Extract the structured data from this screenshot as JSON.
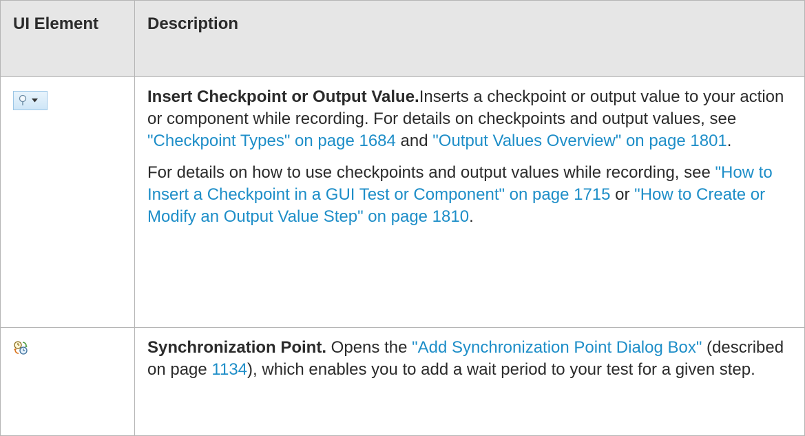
{
  "table": {
    "header": {
      "col1": "UI Element",
      "col2": "Description"
    },
    "rows": [
      {
        "icon": "checkpoint-dropdown-icon",
        "title": "Insert Checkpoint or Output Value.",
        "p1_text1": "Inserts a checkpoint or output value to your action or component while recording. For details on checkpoints and output values, see ",
        "p1_link1": "\"Checkpoint Types\" on page 1684",
        "p1_text2": " and ",
        "p1_link2": "\"Output Values Overview\" on page 1801",
        "p1_text3": ".",
        "p2_text1": "For details on how to use checkpoints and output values while recording, see ",
        "p2_link1": "\"How to Insert a Checkpoint in a GUI Test or Component\" on page 1715",
        "p2_text2": " or ",
        "p2_link2": "\"How to Create or Modify an Output Value Step\" on page 1810",
        "p2_text3": "."
      },
      {
        "icon": "synchronization-point-icon",
        "title": "Synchronization Point.",
        "text1": " Opens the ",
        "link1": "\"Add Synchronization Point Dialog Box\"",
        "text2": " (described on page ",
        "link2": "1134",
        "text3": "), which enables you to add a wait period to your test for a given step."
      }
    ]
  },
  "colors": {
    "header_bg": "#e6e6e6",
    "border": "#b5b5b5",
    "link": "#1e8ec8",
    "text": "#2b2b2b"
  }
}
